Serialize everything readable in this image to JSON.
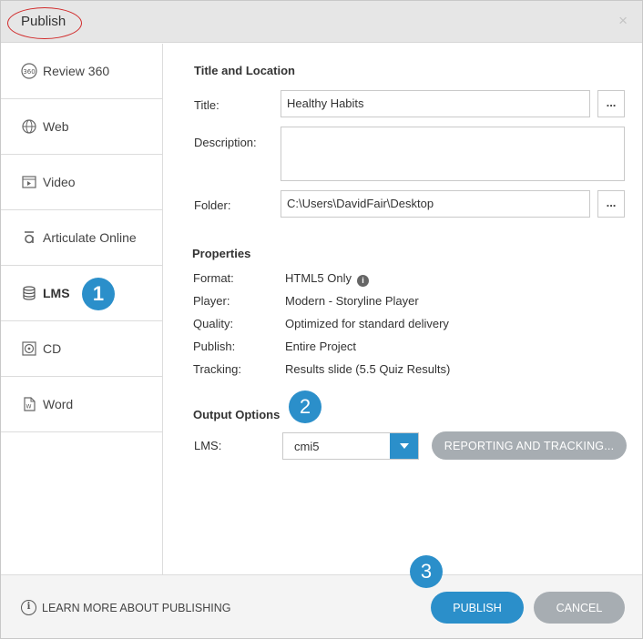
{
  "window": {
    "title": "Publish",
    "close_symbol": "×"
  },
  "sidebar": {
    "items": [
      {
        "label": "Review 360",
        "icon": "review-360-icon",
        "active": false
      },
      {
        "label": "Web",
        "icon": "globe-icon",
        "active": false
      },
      {
        "label": "Video",
        "icon": "video-icon",
        "active": false
      },
      {
        "label": "Articulate Online",
        "icon": "articulate-online-icon",
        "active": false
      },
      {
        "label": "LMS",
        "icon": "database-icon",
        "active": true
      },
      {
        "label": "CD",
        "icon": "cd-icon",
        "active": false
      },
      {
        "label": "Word",
        "icon": "word-document-icon",
        "active": false
      }
    ]
  },
  "annotations": {
    "badge1": "1",
    "badge2": "2",
    "badge3": "3"
  },
  "title_location": {
    "heading": "Title and Location",
    "title_label": "Title:",
    "title_value": "Healthy Habits",
    "description_label": "Description:",
    "description_value": "",
    "folder_label": "Folder:",
    "folder_value": "C:\\Users\\DavidFair\\Desktop",
    "browse_label": "..."
  },
  "properties": {
    "heading": "Properties",
    "rows": [
      {
        "label": "Format:",
        "value": "HTML5 Only"
      },
      {
        "label": "Player:",
        "value": "Modern - Storyline Player"
      },
      {
        "label": "Quality:",
        "value": "Optimized for standard delivery"
      },
      {
        "label": "Publish:",
        "value": "Entire Project"
      },
      {
        "label": "Tracking:",
        "value": "Results slide (5.5 Quiz Results)"
      }
    ],
    "info_symbol": "i"
  },
  "output_options": {
    "heading": "Output Options",
    "lms_label": "LMS:",
    "lms_selected": "cmi5",
    "reporting_button": "REPORTING AND TRACKING..."
  },
  "footer": {
    "learn_more": "LEARN MORE ABOUT PUBLISHING",
    "learn_icon": "i",
    "publish_button": "PUBLISH",
    "cancel_button": "CANCEL"
  },
  "colors": {
    "accent": "#2b8fca",
    "secondary_button": "#a7adb2",
    "annotation_ellipse": "#d12a2a"
  }
}
